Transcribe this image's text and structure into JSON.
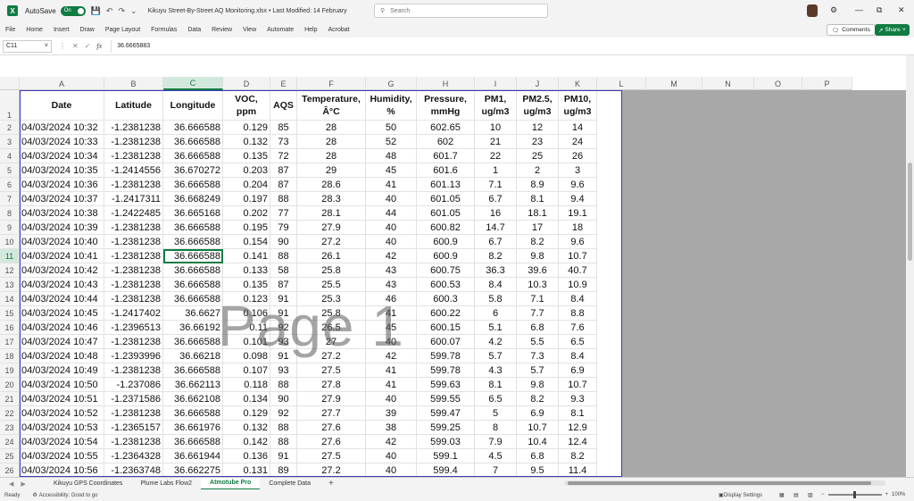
{
  "titlebar": {
    "app_icon": "X",
    "autosave_label": "AutoSave",
    "autosave_state": "On",
    "save_icon": "save-icon",
    "undo_icon": "undo-icon",
    "redo_icon": "redo-icon",
    "document_title": "Kikuyu Street-By-Street AQ Monitoring.xlsx  •  Last Modified: 14 February",
    "search_placeholder": "Search",
    "minimize": "—",
    "maximize": "⧉",
    "close": "✕"
  },
  "menu": [
    "File",
    "Home",
    "Insert",
    "Draw",
    "Page Layout",
    "Formulas",
    "Data",
    "Review",
    "View",
    "Automate",
    "Help",
    "Acrobat"
  ],
  "actions": {
    "comments": "Comments",
    "share": "Share"
  },
  "formula_bar": {
    "name_box": "C11",
    "formula": "36.6665883",
    "fx": "fx"
  },
  "columns": [
    "A",
    "B",
    "C",
    "D",
    "E",
    "F",
    "G",
    "H",
    "I",
    "J",
    "K",
    "L",
    "M",
    "N",
    "O",
    "P"
  ],
  "headers": [
    "Date",
    "Latitude",
    "Longitude",
    "VOC, ppm",
    "AQS",
    "Temperature, Â°C",
    "Humidity, %",
    "Pressure, mmHg",
    "PM1, ug/m3",
    "PM2.5, ug/m3",
    "PM10, ug/m3"
  ],
  "rows": [
    [
      "04/03/2024 10:32",
      "-1.2381238",
      "36.666588",
      "0.129",
      "85",
      "28",
      "50",
      "602.65",
      "10",
      "12",
      "14"
    ],
    [
      "04/03/2024 10:33",
      "-1.2381238",
      "36.666588",
      "0.132",
      "73",
      "28",
      "52",
      "602",
      "21",
      "23",
      "24"
    ],
    [
      "04/03/2024 10:34",
      "-1.2381238",
      "36.666588",
      "0.135",
      "72",
      "28",
      "48",
      "601.7",
      "22",
      "25",
      "26"
    ],
    [
      "04/03/2024 10:35",
      "-1.2414556",
      "36.670272",
      "0.203",
      "87",
      "29",
      "45",
      "601.6",
      "1",
      "2",
      "3"
    ],
    [
      "04/03/2024 10:36",
      "-1.2381238",
      "36.666588",
      "0.204",
      "87",
      "28.6",
      "41",
      "601.13",
      "7.1",
      "8.9",
      "9.6"
    ],
    [
      "04/03/2024 10:37",
      "-1.2417311",
      "36.668249",
      "0.197",
      "88",
      "28.3",
      "40",
      "601.05",
      "6.7",
      "8.1",
      "9.4"
    ],
    [
      "04/03/2024 10:38",
      "-1.2422485",
      "36.665168",
      "0.202",
      "77",
      "28.1",
      "44",
      "601.05",
      "16",
      "18.1",
      "19.1"
    ],
    [
      "04/03/2024 10:39",
      "-1.2381238",
      "36.666588",
      "0.195",
      "79",
      "27.9",
      "40",
      "600.82",
      "14.7",
      "17",
      "18"
    ],
    [
      "04/03/2024 10:40",
      "-1.2381238",
      "36.666588",
      "0.154",
      "90",
      "27.2",
      "40",
      "600.9",
      "6.7",
      "8.2",
      "9.6"
    ],
    [
      "04/03/2024 10:41",
      "-1.2381238",
      "36.666588",
      "0.141",
      "88",
      "26.1",
      "42",
      "600.9",
      "8.2",
      "9.8",
      "10.7"
    ],
    [
      "04/03/2024 10:42",
      "-1.2381238",
      "36.666588",
      "0.133",
      "58",
      "25.8",
      "43",
      "600.75",
      "36.3",
      "39.6",
      "40.7"
    ],
    [
      "04/03/2024 10:43",
      "-1.2381238",
      "36.666588",
      "0.135",
      "87",
      "25.5",
      "43",
      "600.53",
      "8.4",
      "10.3",
      "10.9"
    ],
    [
      "04/03/2024 10:44",
      "-1.2381238",
      "36.666588",
      "0.123",
      "91",
      "25.3",
      "46",
      "600.3",
      "5.8",
      "7.1",
      "8.4"
    ],
    [
      "04/03/2024 10:45",
      "-1.2417402",
      "36.6627",
      "0.106",
      "91",
      "25.8",
      "41",
      "600.22",
      "6",
      "7.7",
      "8.8"
    ],
    [
      "04/03/2024 10:46",
      "-1.2396513",
      "36.66192",
      "0.11",
      "92",
      "26.5",
      "45",
      "600.15",
      "5.1",
      "6.8",
      "7.6"
    ],
    [
      "04/03/2024 10:47",
      "-1.2381238",
      "36.666588",
      "0.101",
      "93",
      "27",
      "40",
      "600.07",
      "4.2",
      "5.5",
      "6.5"
    ],
    [
      "04/03/2024 10:48",
      "-1.2393996",
      "36.66218",
      "0.098",
      "91",
      "27.2",
      "42",
      "599.78",
      "5.7",
      "7.3",
      "8.4"
    ],
    [
      "04/03/2024 10:49",
      "-1.2381238",
      "36.666588",
      "0.107",
      "93",
      "27.5",
      "41",
      "599.78",
      "4.3",
      "5.7",
      "6.9"
    ],
    [
      "04/03/2024 10:50",
      "-1.237086",
      "36.662113",
      "0.118",
      "88",
      "27.8",
      "41",
      "599.63",
      "8.1",
      "9.8",
      "10.7"
    ],
    [
      "04/03/2024 10:51",
      "-1.2371586",
      "36.662108",
      "0.134",
      "90",
      "27.9",
      "40",
      "599.55",
      "6.5",
      "8.2",
      "9.3"
    ],
    [
      "04/03/2024 10:52",
      "-1.2381238",
      "36.666588",
      "0.129",
      "92",
      "27.7",
      "39",
      "599.47",
      "5",
      "6.9",
      "8.1"
    ],
    [
      "04/03/2024 10:53",
      "-1.2365157",
      "36.661976",
      "0.132",
      "88",
      "27.6",
      "38",
      "599.25",
      "8",
      "10.7",
      "12.9"
    ],
    [
      "04/03/2024 10:54",
      "-1.2381238",
      "36.666588",
      "0.142",
      "88",
      "27.6",
      "42",
      "599.03",
      "7.9",
      "10.4",
      "12.4"
    ],
    [
      "04/03/2024 10:55",
      "-1.2364328",
      "36.661944",
      "0.136",
      "91",
      "27.5",
      "40",
      "599.1",
      "4.5",
      "6.8",
      "8.2"
    ],
    [
      "04/03/2024 10:56",
      "-1.2363748",
      "36.662275",
      "0.131",
      "89",
      "27.2",
      "40",
      "599.4",
      "7",
      "9.5",
      "11.4"
    ]
  ],
  "watermark": "Page 1",
  "tabs": [
    "Kikuyu GPS Coordinates",
    "Plume Labs Flow2",
    "Atmotube Pro",
    "Complete Data"
  ],
  "active_tab": "Atmotube Pro",
  "add_tab": "+",
  "status": {
    "ready": "Ready",
    "accessibility": "Accessibility: Good to go",
    "display_settings": "Display Settings",
    "zoom": "100%"
  }
}
